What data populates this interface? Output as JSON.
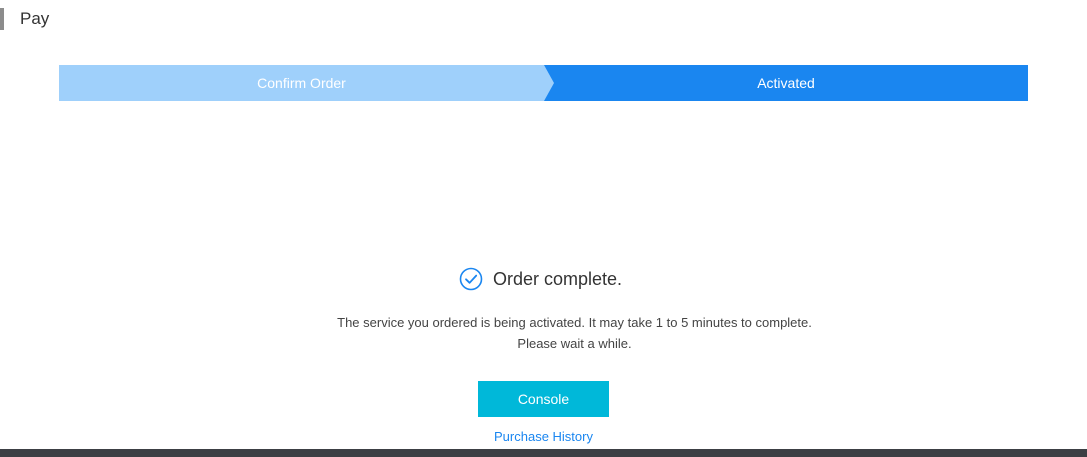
{
  "header": {
    "title": "Pay"
  },
  "stepper": {
    "steps": [
      {
        "label": "Confirm Order",
        "state": "done"
      },
      {
        "label": "Activated",
        "state": "active"
      }
    ]
  },
  "result": {
    "icon": "check-circle-icon",
    "title": "Order complete.",
    "description_line1": "The service you ordered is being activated. It may take 1 to 5 minutes to complete.",
    "description_line2": "Please wait a while."
  },
  "actions": {
    "console_label": "Console",
    "history_link": "Purchase History"
  },
  "colors": {
    "step_done": "#9fd0fb",
    "step_active": "#1a86f0",
    "primary_button": "#00b8d9",
    "link": "#1a86f0",
    "footer": "#3c3f44"
  }
}
